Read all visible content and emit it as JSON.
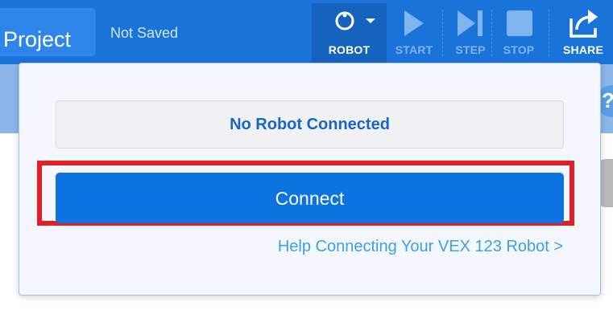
{
  "header": {
    "project_name": "Project",
    "save_status": "Not Saved"
  },
  "toolbar": {
    "robot_label": "ROBOT",
    "start_label": "START",
    "step_label": "STEP",
    "stop_label": "STOP",
    "share_label": "SHARE"
  },
  "dropdown": {
    "status": "No Robot Connected",
    "connect_label": "Connect",
    "help_link": "Help Connecting Your VEX 123 Robot >"
  },
  "icons": {
    "robot": "robot-connection-icon",
    "caret": "caret-down-icon",
    "start": "play-icon",
    "step": "step-icon",
    "stop": "stop-icon",
    "share": "share-icon"
  },
  "colors": {
    "toolbar": "#1a73d9",
    "connect_button": "#0c73e1",
    "highlight": "#e31e24",
    "status_text": "#1a64c2",
    "link": "#3aa0e8"
  }
}
